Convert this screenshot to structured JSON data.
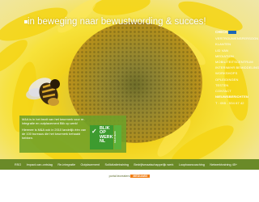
{
  "hero": {
    "headline": "in beweging naar bewustwording & succes!"
  },
  "side_menu": {
    "logo_label": "CHECK",
    "items": [
      {
        "label": "VERTROUWENSPERSOON",
        "active": false
      },
      {
        "label": "KLANTEN",
        "active": false
      },
      {
        "label": "LID VAN",
        "active": false
      },
      {
        "label": "MEDIATION",
        "active": false
      },
      {
        "label": "MOBILITEITSCENTRUM",
        "active": false
      },
      {
        "label": "INTERIM/HR BEMIDDELING",
        "active": false
      },
      {
        "label": "WORKSHOPS",
        "active": false
      },
      {
        "label": "OPLEIDINGEN",
        "active": false
      },
      {
        "label": "TESTEN",
        "active": false
      },
      {
        "label": "CONTACT",
        "active": false
      },
      {
        "label": "NIEUWSBERICHTEN",
        "active": true
      }
    ],
    "phone": "T : 055 - 534 67 42"
  },
  "info_box": {
    "paragraph_1": "M&A is in het bezit van het keurmerk voor re-integratie en outplacement Blik op werk!",
    "paragraph_2": "Hiermee is M&A ook in 2010 landelijk één van de 100 bureaus die het keurmerk behaald hebben."
  },
  "badge": {
    "text_line_1": "BLIK",
    "text_line_2": "OP",
    "text_line_3": "WERK",
    "text_line_4": "NL",
    "side_text": "KEURMERK"
  },
  "bottom_nav": {
    "items": [
      "RSO",
      "Impact-van-ontslag",
      "Re-integratie",
      "Outplacement",
      "Sollicitatietraining",
      "Bedrijfsmaatschappelijk werk",
      "Loopbaancoaching",
      "Netwerktraining 45+"
    ]
  },
  "footer": {
    "text": "portal lecreaters",
    "brand": "MEDIAMIX"
  }
}
